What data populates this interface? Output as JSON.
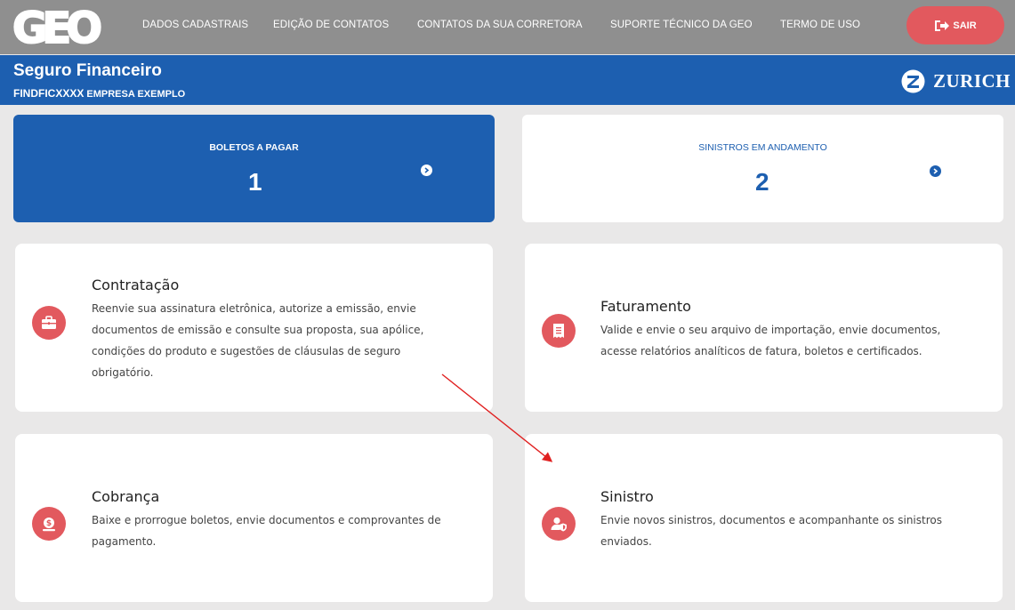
{
  "nav": {
    "logo_text": "GEO",
    "links": [
      "DADOS CADASTRAIS",
      "EDIÇÃO DE CONTATOS",
      "CONTATOS DA SUA CORRETORA",
      "SUPORTE TÉCNICO DA GEO",
      "TERMO DE USO"
    ],
    "logout_label": "SAIR"
  },
  "header": {
    "title": "Seguro Financeiro",
    "policy_code": "FINDFICXXXX",
    "company": "EMPRESA EXEMPLO",
    "insurer": "ZURICH"
  },
  "summary": [
    {
      "label": "BOLETOS A PAGAR",
      "value": "1"
    },
    {
      "label": "SINISTROS EM ANDAMENTO",
      "value": "2"
    }
  ],
  "services": [
    {
      "title": "Contratação",
      "lines": [
        "Reenvie sua assinatura eletrônica, autorize a emissão, envie",
        "documentos de emissão e consulte sua proposta, sua apólice,",
        "condições do produto e sugestões de cláusulas de seguro",
        "obrigatório."
      ],
      "icon": "briefcase-icon"
    },
    {
      "title": "Faturamento",
      "lines": [
        "Valide e envie o seu arquivo de importação, envie documentos,",
        "acesse relatórios analíticos de fatura, boletos e certificados."
      ],
      "icon": "receipt-icon"
    },
    {
      "title": "Cobrança",
      "lines": [
        "Baixe e prorrogue boletos, envie documentos e comprovantes de",
        "pagamento."
      ],
      "icon": "money-bag-icon"
    },
    {
      "title": "Sinistro",
      "lines": [
        "Envie novos sinistros, documentos e acompanhante os sinistros",
        "enviados."
      ],
      "icon": "user-shield-icon"
    }
  ],
  "colors": {
    "nav_bg": "#8f8f8f",
    "brand_blue": "#1d5fb0",
    "accent_red": "#e2595e",
    "page_bg": "#e9e8e8",
    "annotation_arrow": "#e02020"
  }
}
